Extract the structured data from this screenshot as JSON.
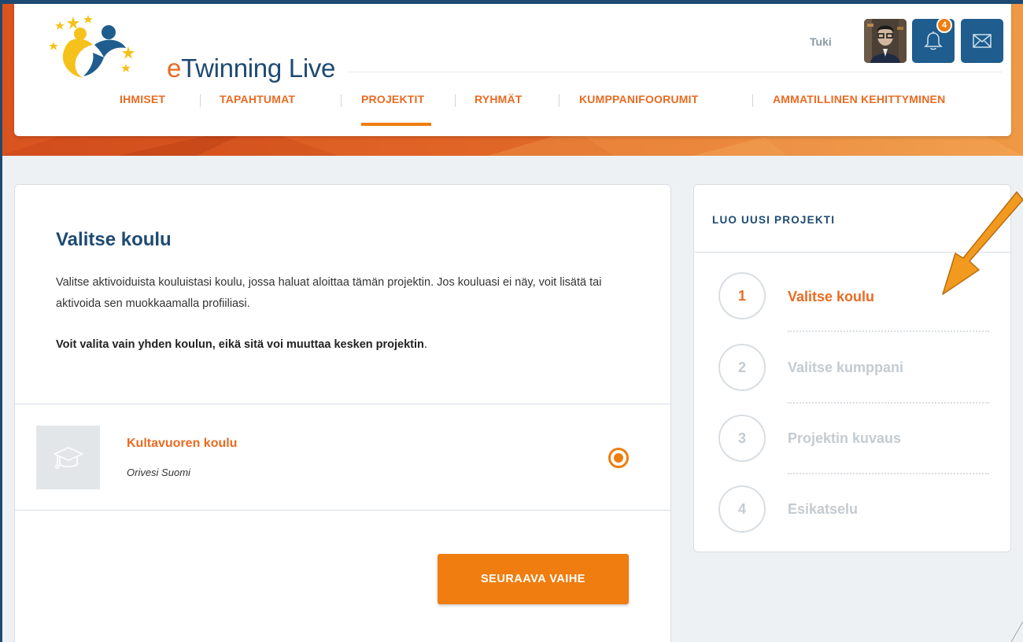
{
  "header": {
    "logo": {
      "brand_e": "e",
      "brand_text": "Twinning Live"
    },
    "support_link": "Tuki",
    "notifications_count": "4",
    "nav": [
      {
        "label": "IHMISET"
      },
      {
        "label": "TAPAHTUMAT"
      },
      {
        "label": "PROJEKTIT",
        "active": true
      },
      {
        "label": "RYHMÄT"
      },
      {
        "label": "KUMPPANIFOORUMIT"
      },
      {
        "label": "AMMATILLINEN KEHITTYMINEN"
      }
    ]
  },
  "main": {
    "title": "Valitse koulu",
    "description": "Valitse aktivoiduista kouluistasi koulu, jossa haluat aloittaa tämän projektin. Jos kouluasi ei näy, voit lisätä tai aktivoida sen muokkaamalla profiiliasi.",
    "note": "Voit valita vain yhden koulun, eikä sitä voi muuttaa kesken projektin",
    "note_end": ".",
    "school": {
      "name": "Kultavuoren koulu",
      "location": "Orivesi Suomi",
      "selected": true
    },
    "next_button": "SEURAAVA VAIHE"
  },
  "sidebar": {
    "title": "LUO UUSI PROJEKTI",
    "steps": [
      {
        "number": "1",
        "label": "Valitse koulu",
        "active": true
      },
      {
        "number": "2",
        "label": "Valitse kumppani",
        "active": false
      },
      {
        "number": "3",
        "label": "Projektin kuvaus",
        "active": false
      },
      {
        "number": "4",
        "label": "Esikatselu",
        "active": false
      }
    ]
  },
  "colors": {
    "accent": "#ef7d0f",
    "primary": "#1e4a72",
    "inactive": "#c4cbd1",
    "background": "#eef1f4"
  },
  "icons": [
    "bell-icon",
    "mail-icon",
    "graduation-cap-icon",
    "etwinning-logo",
    "annotation-arrow"
  ]
}
